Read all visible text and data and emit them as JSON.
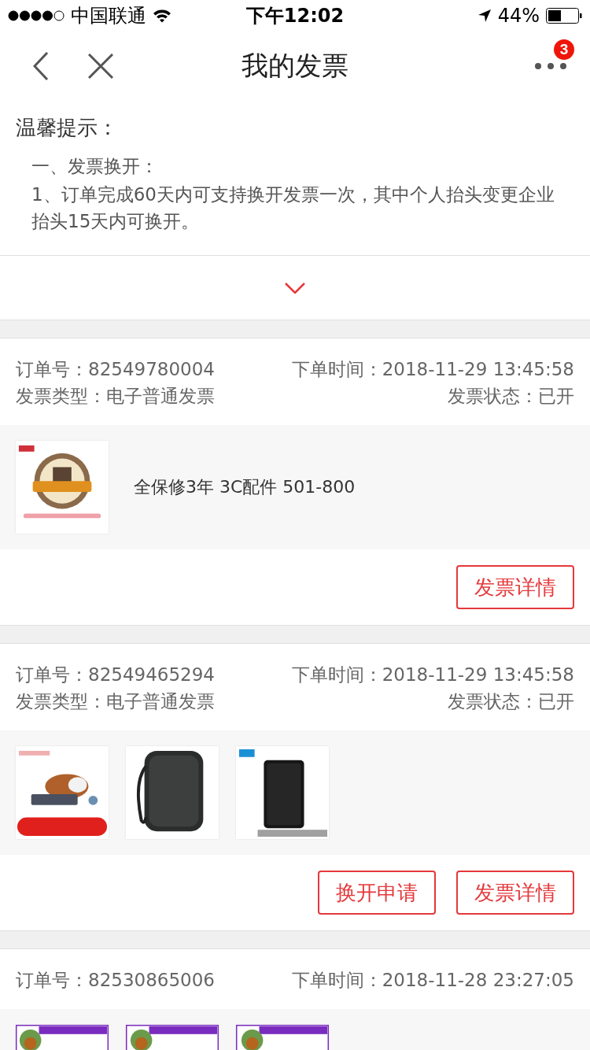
{
  "status_bar": {
    "carrier": "中国联通",
    "time": "下午12:02",
    "battery": "44%"
  },
  "nav": {
    "title": "我的发票",
    "badge": "3"
  },
  "tips": {
    "title": "温馨提示：",
    "section": "一、发票换开：",
    "text": "1、订单完成60天内可支持换开发票一次，其中个人抬头变更企业抬头15天内可换开。"
  },
  "orders": [
    {
      "order_no": "订单号：82549780004",
      "time": "下单时间：2018-11-29 13:45:58",
      "type": "发票类型：电子普通发票",
      "status": "发票状态：已开",
      "products": [
        {
          "kind": "picture",
          "name": "全保修3年 3C配件 501-800"
        }
      ],
      "buttons": [
        "发票详情"
      ]
    },
    {
      "order_no": "订单号：82549465294",
      "time": "下单时间：2018-11-29 13:45:58",
      "type": "发票类型：电子普通发票",
      "status": "发票状态：已开",
      "products": [
        {
          "kind": "picture"
        },
        {
          "kind": "picture"
        },
        {
          "kind": "picture"
        }
      ],
      "buttons": [
        "换开申请",
        "发票详情"
      ]
    },
    {
      "order_no": "订单号：82530865006",
      "time": "下单时间：2018-11-28 23:27:05",
      "products": [
        {
          "kind": "picture"
        },
        {
          "kind": "picture"
        },
        {
          "kind": "picture"
        }
      ]
    }
  ]
}
